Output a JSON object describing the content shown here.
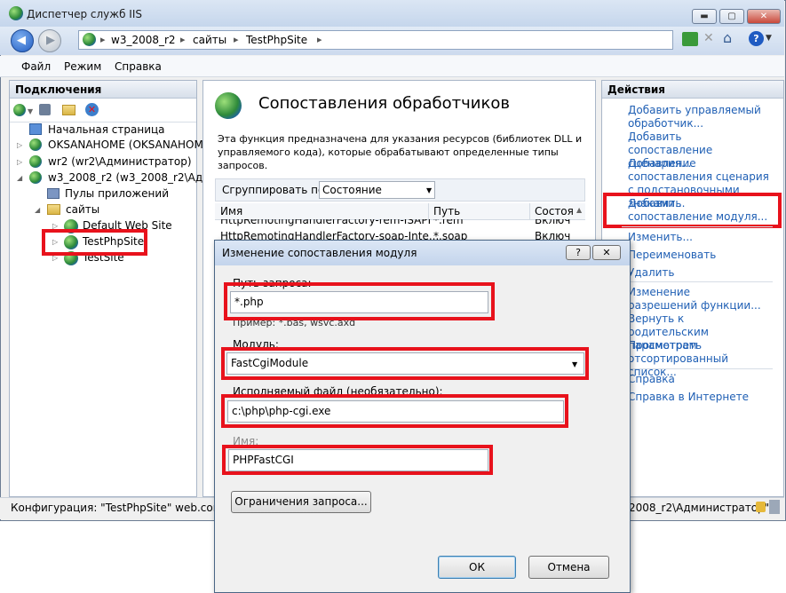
{
  "window": {
    "title": "Диспетчер служб IIS",
    "controls": [
      "▬",
      "▢",
      "✕"
    ]
  },
  "address": {
    "segments": [
      "w3_2008_r2",
      "сайты",
      "TestPhpSite"
    ]
  },
  "menu": {
    "items": [
      "Файл",
      "Режим",
      "Справка"
    ]
  },
  "connections": {
    "header": "Подключения",
    "tree": [
      {
        "label": "Начальная страница"
      },
      {
        "label": "OKSANAHOME (OKSANAHOME"
      },
      {
        "label": "wr2 (wr2\\Администратор)"
      },
      {
        "label": "w3_2008_r2 (w3_2008_r2\\Админ"
      },
      {
        "label": "Пулы приложений"
      },
      {
        "label": "сайты"
      },
      {
        "label": "Default Web Site"
      },
      {
        "label": "TestPhpSite"
      },
      {
        "label": "TestSite"
      }
    ]
  },
  "center": {
    "title": "Сопоставления обработчиков",
    "description_lines": [
      "Эта функция предназначена для указания ресурсов (библиотек DLL и",
      "управляемого кода), которые обрабатывают определенные типы",
      "запросов."
    ],
    "group_label": "Сгруппировать по:",
    "group_value": "Состояние",
    "columns": [
      "Имя",
      "Путь",
      "Состоя"
    ],
    "rows": [
      {
        "name": "HttpRemotingHandlerFactory-rem-ISAPI",
        "path": "*.rem",
        "state": "Включ"
      },
      {
        "name": "HttpRemotingHandlerFactory-soap-Inte...",
        "path": "*.soap",
        "state": "Включ"
      }
    ]
  },
  "actions": {
    "header": "Действия",
    "items": [
      "Добавить управляемый обработчик...",
      "Добавить сопоставление сценария...",
      "Добавление сопоставления сценария с подстановочными знаками...",
      "Добавить сопоставление модуля...",
      "Изменить...",
      "Переименовать",
      "Удалить",
      "Изменение разрешений функции...",
      "Вернуть к родительским параметрам",
      "Просмотреть отсортированный список...",
      "Справка",
      "Справка в Интернете"
    ]
  },
  "status": {
    "config": "Конфигурация: \"TestPhpSite\" web.config",
    "user": "2008_r2\\Администратор\")"
  },
  "dialog": {
    "title": "Изменение сопоставления модуля",
    "controls": [
      "?",
      "✕"
    ],
    "path_label": "Путь запроса:",
    "path_value": "*.php",
    "example": "Пример: *.bas, wsvc.axd",
    "module_label": "Модуль:",
    "module_value": "FastCgiModule",
    "exe_label": "Исполняемый файл (необязательно):",
    "exe_value": "c:\\php\\php-cgi.exe",
    "name_label": "Имя:",
    "name_value": "PHPFastCGI",
    "restrictions_button": "Ограничения запроса...",
    "ok_button": "ОК",
    "cancel_button": "Отмена"
  },
  "colors": {
    "highlight": "#e8121c",
    "link": "#1f5fb4"
  }
}
